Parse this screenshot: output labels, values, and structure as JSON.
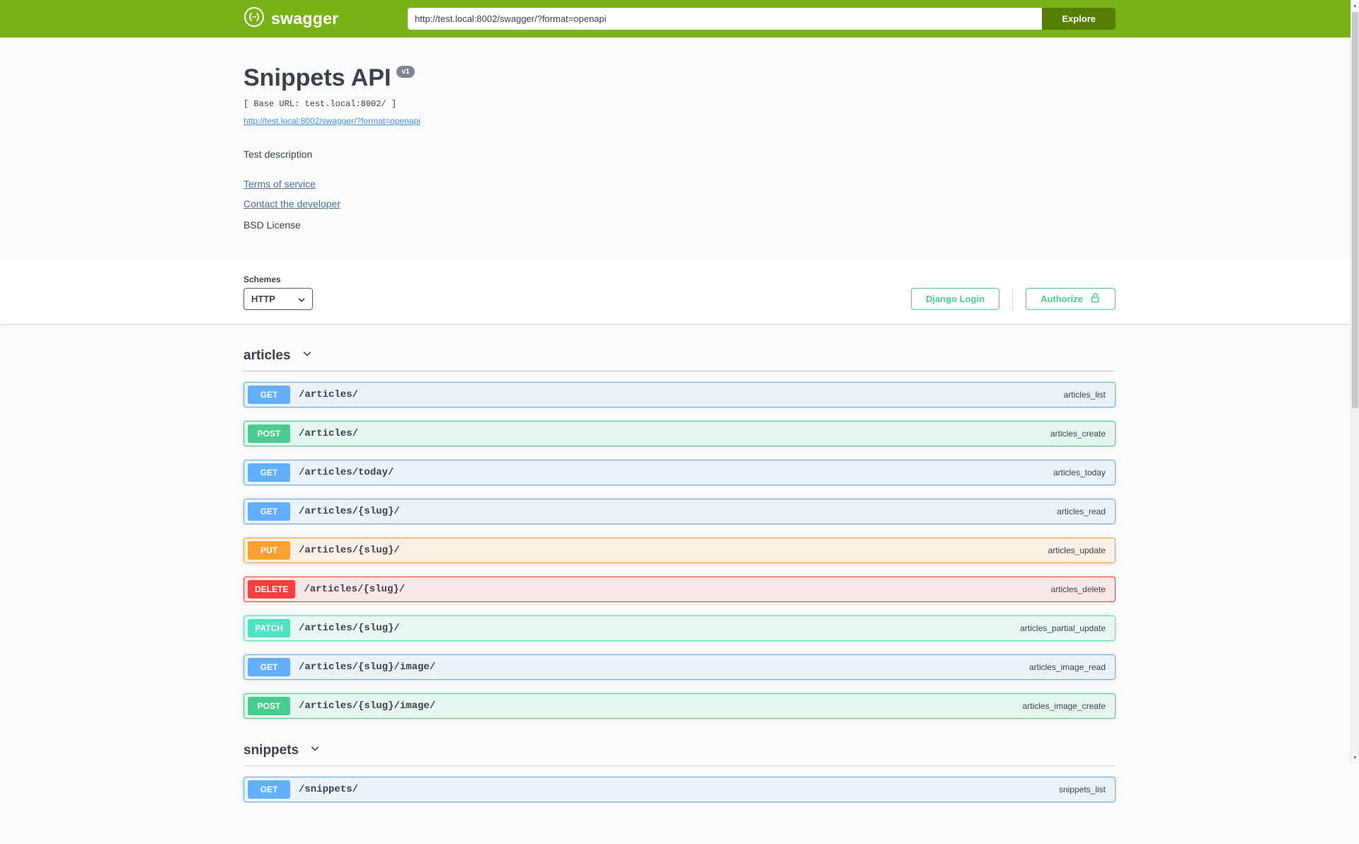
{
  "topbar": {
    "brand": "swagger",
    "url_value": "http://test.local:8002/swagger/?format=openapi",
    "explore_label": "Explore"
  },
  "info": {
    "title": "Snippets API",
    "version_badge": "v1",
    "base_url": "[ Base URL: test.local:8002/ ]",
    "spec_link": "http://test.local:8002/swagger/?format=openapi",
    "description": "Test description",
    "terms_link": "Terms of service",
    "contact_link": "Contact the developer",
    "license": "BSD License"
  },
  "schemes": {
    "label": "Schemes",
    "selected": "HTTP",
    "django_login_label": "Django Login",
    "authorize_label": "Authorize"
  },
  "tags": [
    {
      "name": "articles",
      "operations": [
        {
          "method": "GET",
          "path": "/articles/",
          "opid": "articles_list"
        },
        {
          "method": "POST",
          "path": "/articles/",
          "opid": "articles_create"
        },
        {
          "method": "GET",
          "path": "/articles/today/",
          "opid": "articles_today"
        },
        {
          "method": "GET",
          "path": "/articles/{slug}/",
          "opid": "articles_read"
        },
        {
          "method": "PUT",
          "path": "/articles/{slug}/",
          "opid": "articles_update"
        },
        {
          "method": "DELETE",
          "path": "/articles/{slug}/",
          "opid": "articles_delete"
        },
        {
          "method": "PATCH",
          "path": "/articles/{slug}/",
          "opid": "articles_partial_update"
        },
        {
          "method": "GET",
          "path": "/articles/{slug}/image/",
          "opid": "articles_image_read"
        },
        {
          "method": "POST",
          "path": "/articles/{slug}/image/",
          "opid": "articles_image_create"
        }
      ]
    },
    {
      "name": "snippets",
      "operations": [
        {
          "method": "GET",
          "path": "/snippets/",
          "opid": "snippets_list"
        }
      ]
    }
  ],
  "icons": {
    "scroll_up": "▲",
    "scroll_down": "▼"
  },
  "colors": {
    "topbar_green": "#7ab317",
    "explore_button": "#547f00",
    "accent_green": "#49cc90",
    "get": "#61affe",
    "post": "#49cc90",
    "put": "#fca130",
    "delete": "#f93e3e",
    "patch": "#50e3c2",
    "text": "#3b4151",
    "link_blue": "#4990e2",
    "page_background": "#fafafa"
  }
}
